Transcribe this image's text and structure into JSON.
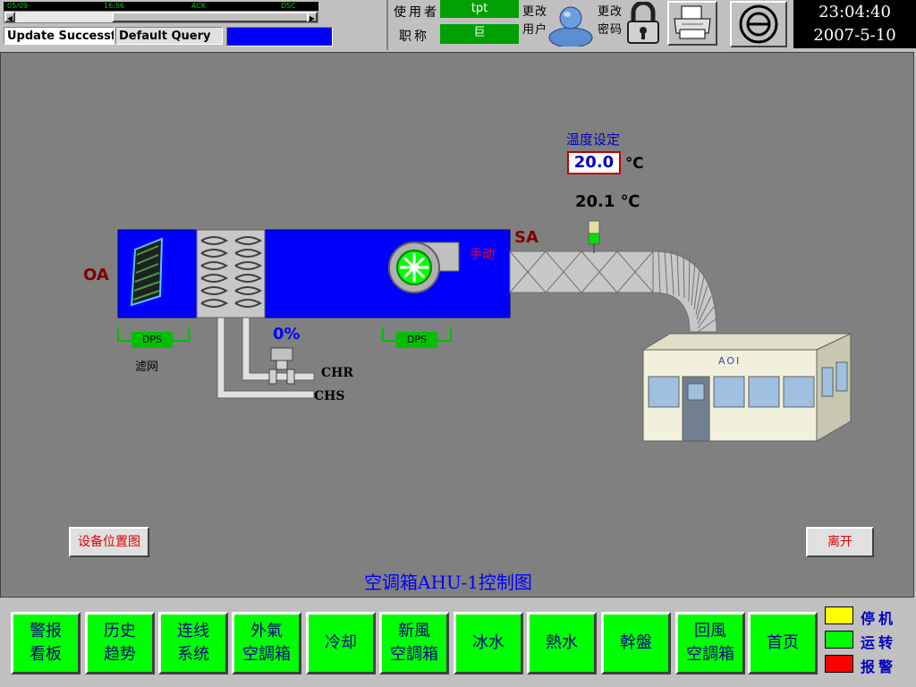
{
  "alarm_strip": {
    "col1": "05/09",
    "col2": "16:56",
    "col3": "ACK",
    "col4": "DSC"
  },
  "status_bar": {
    "message": "Update Successfu",
    "query": "Default Query"
  },
  "user": {
    "user_label": "使用者",
    "user_value": "tpt",
    "title_label": "职称",
    "title_value": "巨",
    "change_user_label": "更改用户",
    "change_password_label": "更改密码"
  },
  "clock": {
    "time": "23:04:40",
    "date": "2007-5-10"
  },
  "diagram": {
    "oa_label": "OA",
    "sa_label": "SA",
    "mode_label": "手动",
    "filter_label": "滤网",
    "dps_label_1": "DPS",
    "dps_label_2": "DPS",
    "valve_percent": "0%",
    "chr_label": "CHR",
    "chs_label": "CHS",
    "temp_setpoint_label": "温度设定",
    "temp_setpoint_value": "20.0",
    "temp_setpoint_unit": "℃",
    "temp_actual": "20.1 ℃",
    "building_label": "AOI",
    "title": "空调箱AHU-1控制图"
  },
  "buttons": {
    "equipment_location": "设备位置图",
    "leave": "离开"
  },
  "nav": [
    "警报\n看板",
    "历史\n趋势",
    "连线\n系统",
    "外氣\n空調箱",
    "冷却",
    "新風\n空調箱",
    "冰水",
    "熱水",
    "幹盤",
    "回風\n空調箱",
    "首页"
  ],
  "legend": [
    {
      "label": "停机",
      "color": "#ffff00"
    },
    {
      "label": "运转",
      "color": "#00ff00"
    },
    {
      "label": "报警",
      "color": "#ff0000"
    }
  ],
  "colors": {
    "ahu_body": "#0000ff",
    "main_bg": "#808080",
    "nav_button": "#00ff00",
    "dps_box": "#00c000"
  }
}
